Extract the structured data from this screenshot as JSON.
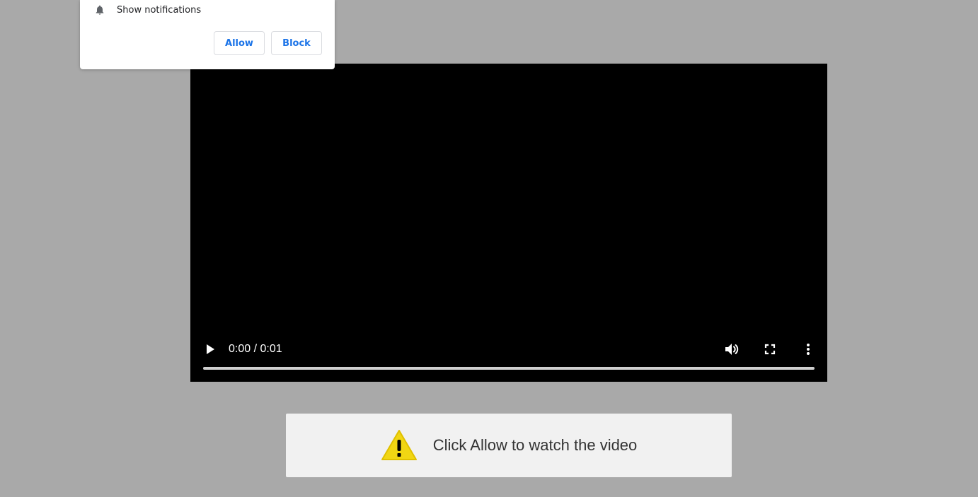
{
  "notification": {
    "icon": "bell-icon",
    "text": "Show notifications",
    "allow_label": "Allow",
    "block_label": "Block",
    "accent_color": "#1a73e8"
  },
  "video": {
    "time_display": "0:00 / 0:01",
    "controls": [
      "play-icon",
      "volume-icon",
      "fullscreen-icon",
      "more-vertical-icon"
    ],
    "progress": 0
  },
  "prompt": {
    "icon": "warning-icon",
    "message": "Click Allow to watch the video"
  }
}
